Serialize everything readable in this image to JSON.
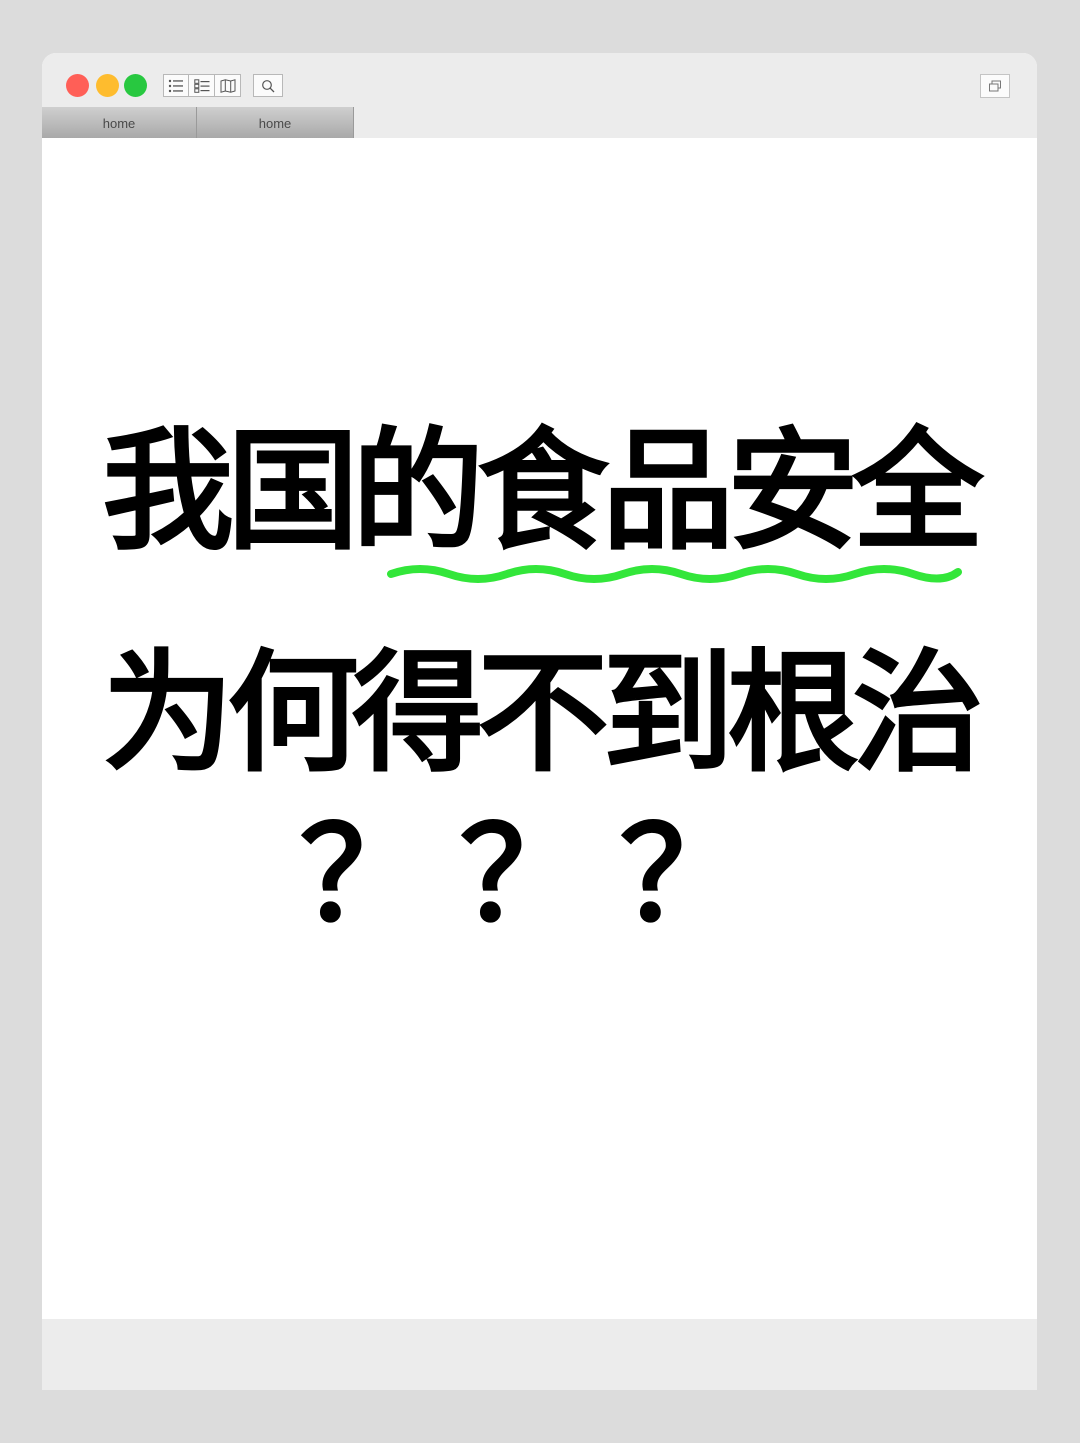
{
  "window": {
    "tabs": [
      {
        "label": "home"
      },
      {
        "label": "home"
      }
    ],
    "icons": {
      "toolbar": [
        "list-icon",
        "checklist-icon",
        "map-icon"
      ],
      "search": "search-icon",
      "restore": "restore-window-icon"
    },
    "colors": {
      "close": "#ff5f57",
      "minimize": "#febc2e",
      "maximize": "#28c840",
      "accent_underline": "#33e63a"
    }
  },
  "content": {
    "headline_line1": "我国的食品安全",
    "headline_line2": "为何得不到根治",
    "headline_line3": "？？？"
  }
}
